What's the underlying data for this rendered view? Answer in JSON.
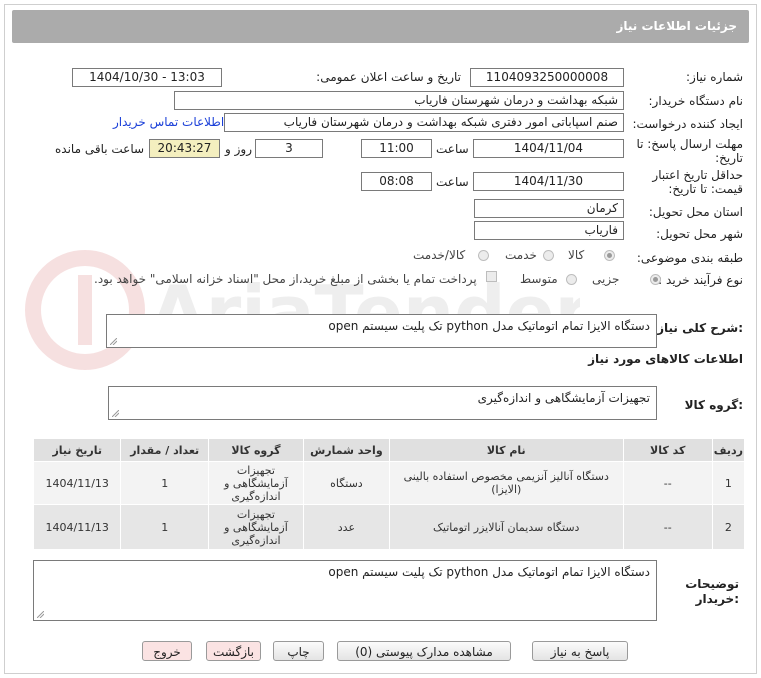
{
  "header": {
    "title": "جزئیات اطلاعات نیاز"
  },
  "fields": {
    "need_number": {
      "label": "شماره نیاز:",
      "value": "1104093250000008"
    },
    "announce": {
      "label": "تاریخ و ساعت اعلان عمومی:",
      "value": "1404/10/30 - 13:03"
    },
    "buyer_org": {
      "label": "نام دستگاه خریدار:",
      "value": "شبکه بهداشت و درمان شهرستان فاریاب"
    },
    "creator": {
      "label": "ایجاد کننده درخواست:",
      "value": "صنم اسپاباتی امور دفتری شبکه بهداشت و درمان شهرستان فاریاب",
      "contact_link": "اطلاعات تماس خریدار"
    },
    "deadline": {
      "label_line1": "مهلت ارسال پاسخ: تا",
      "label_line2": "تاریخ:",
      "date": "1404/11/04",
      "time_label": "ساعت",
      "time": "11:00",
      "days": "3",
      "days_label": "روز و",
      "remaining": "20:43:27",
      "remaining_label": "ساعت باقی مانده"
    },
    "validity": {
      "label_line1": "حداقل تاریخ اعتبار",
      "label_line2": "قیمت: تا تاریخ:",
      "date": "1404/11/30",
      "time_label": "ساعت",
      "time": "08:08"
    },
    "province": {
      "label": "استان محل تحویل:",
      "value": "کرمان"
    },
    "city": {
      "label": "شهر محل تحویل:",
      "value": "فاریاب"
    },
    "category": {
      "label": "طبقه بندی موضوعی:",
      "options": [
        "کالا",
        "خدمت",
        "کالا/خدمت"
      ]
    },
    "process": {
      "label": "نوع فرآیند خرید :",
      "options": [
        "جزیی",
        "متوسط"
      ],
      "payment_note": "پرداخت تمام یا بخشی از مبلغ خرید،از محل \"اسناد خزانه اسلامی\" خواهد بود."
    }
  },
  "description": {
    "label": "شرح کلی نیاز:",
    "value": "دستگاه الایزا تمام اتوماتیک مدل python تک پلیت سیستم open"
  },
  "goods_info": {
    "title": "اطلاعات کالاهای مورد نیاز"
  },
  "goods_group": {
    "label": "گروه کالا:",
    "value": "تجهیزات آزمایشگاهی و اندازه‌گیری"
  },
  "table": {
    "headers": [
      "ردیف",
      "کد کالا",
      "نام کالا",
      "واحد شمارش",
      "گروه کالا",
      "تعداد / مقدار",
      "تاریخ نیاز"
    ],
    "rows": [
      {
        "idx": "1",
        "code": "--",
        "name": "دستگاه آنالیز آنزیمی مخصوص استفاده بالینی (الایزا)",
        "unit": "دستگاه",
        "group": "تجهیزات آزمایشگاهی و اندازه‌گیری",
        "qty": "1",
        "date": "1404/11/13"
      },
      {
        "idx": "2",
        "code": "--",
        "name": "دستگاه سدیمان آنالایزر اتوماتیک",
        "unit": "عدد",
        "group": "تجهیزات آزمایشگاهی و اندازه‌گیری",
        "qty": "1",
        "date": "1404/11/13"
      }
    ]
  },
  "buyer_notes": {
    "label_line1": "توضیحات",
    "label_line2": "خریدار:",
    "value": "دستگاه الایزا تمام اتوماتیک مدل python تک پلیت سیستم open"
  },
  "buttons": {
    "reply": "پاسخ به نیاز",
    "attachments": "مشاهده مدارک پیوستی (0)",
    "print": "چاپ",
    "back": "بازگشت",
    "exit": "خروج"
  },
  "colors": {
    "header_bg": "#ababab",
    "remaining_bg": "#f4efbf",
    "link": "#1a3fd8",
    "table_header": "#e0e0e0"
  }
}
